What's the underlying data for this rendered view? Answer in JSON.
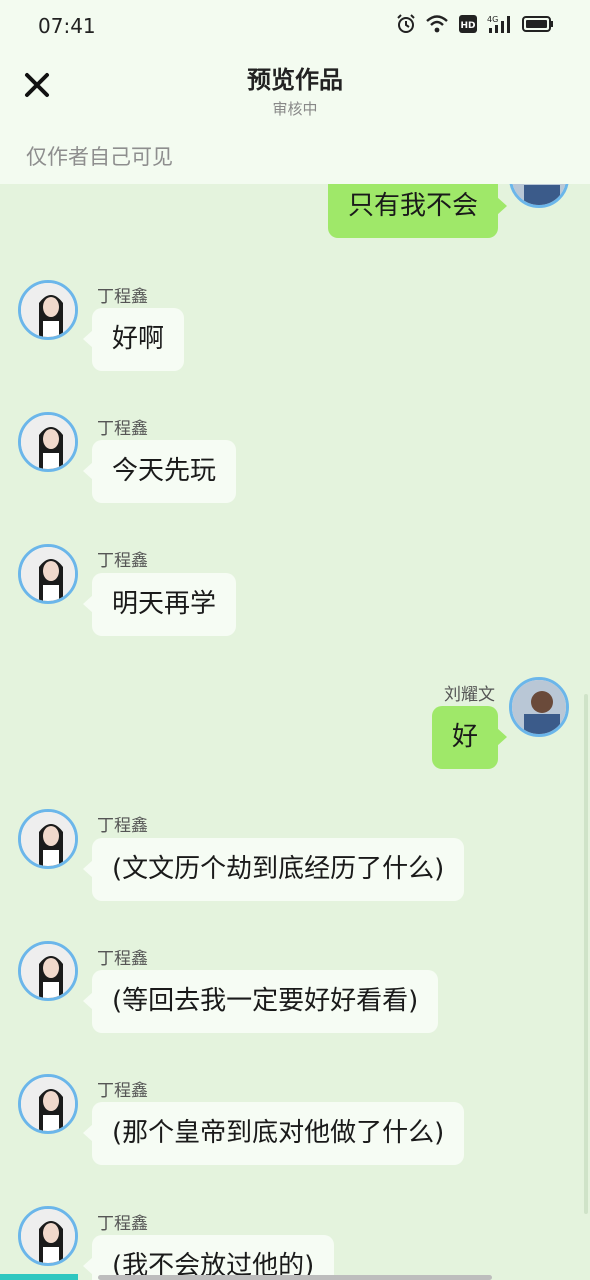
{
  "status_bar": {
    "time": "07:41",
    "icons": [
      "alarm-icon",
      "wifi-icon",
      "hd-icon",
      "signal-4g-icon",
      "battery-icon"
    ],
    "network": "4G",
    "hd": "HD"
  },
  "header": {
    "title": "预览作品",
    "subtitle": "审核中",
    "visibility_note": "仅作者自己可见",
    "close_icon": "close-icon"
  },
  "colors": {
    "background": "#e4f3dd",
    "header_bg": "#f3fbf0",
    "bubble_left": "#f6fcf4",
    "bubble_right": "#9fe869",
    "avatar_ring": "#6bb6ea"
  },
  "messages": [
    {
      "side": "right",
      "sender": "",
      "text": "只有我不会"
    },
    {
      "side": "left",
      "sender": "丁程鑫",
      "text": "好啊"
    },
    {
      "side": "left",
      "sender": "丁程鑫",
      "text": "今天先玩"
    },
    {
      "side": "left",
      "sender": "丁程鑫",
      "text": "明天再学"
    },
    {
      "side": "right",
      "sender": "刘耀文",
      "text": "好"
    },
    {
      "side": "left",
      "sender": "丁程鑫",
      "text": "(文文历个劫到底经历了什么)"
    },
    {
      "side": "left",
      "sender": "丁程鑫",
      "text": "(等回去我一定要好好看看)"
    },
    {
      "side": "left",
      "sender": "丁程鑫",
      "text": "(那个皇帝到底对他做了什么)"
    },
    {
      "side": "left",
      "sender": "丁程鑫",
      "text": "(我不会放过他的)"
    }
  ]
}
